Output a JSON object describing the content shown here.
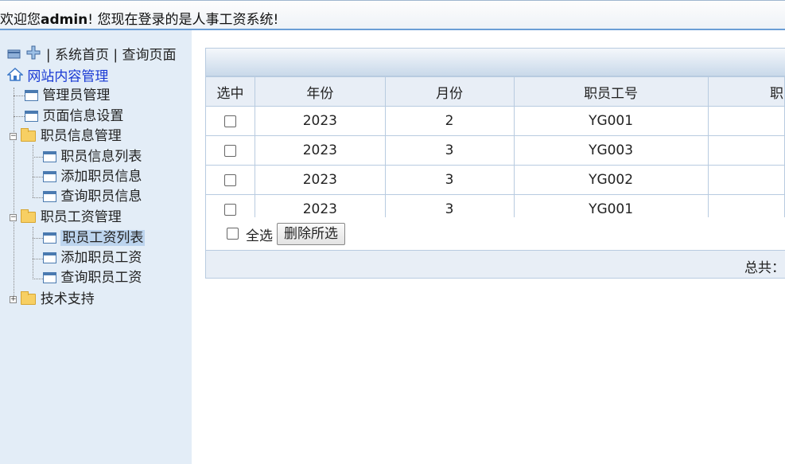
{
  "header": {
    "welcome_prefix": "欢迎您",
    "user": "admin",
    "welcome_suffix": "! 您现在登录的是人事工资系统!"
  },
  "sidebar": {
    "toolbar": {
      "home": "系统首页",
      "sep1": "|",
      "sep0": "|",
      "query": "查询页面"
    },
    "root": "网站内容管理",
    "items": [
      {
        "label": "管理员管理"
      },
      {
        "label": "页面信息设置"
      },
      {
        "label": "职员信息管理"
      },
      {
        "label": "职员信息列表"
      },
      {
        "label": "添加职员信息"
      },
      {
        "label": "查询职员信息"
      },
      {
        "label": "职员工资管理"
      },
      {
        "label": "职员工资列表"
      },
      {
        "label": "添加职员工资"
      },
      {
        "label": "查询职员工资"
      },
      {
        "label": "技术支持"
      }
    ]
  },
  "table": {
    "headers": [
      "选中",
      "年份",
      "月份",
      "职员工号",
      "职"
    ],
    "rows": [
      {
        "year": "2023",
        "month": "2",
        "emp": "YG001"
      },
      {
        "year": "2023",
        "month": "3",
        "emp": "YG003"
      },
      {
        "year": "2023",
        "month": "3",
        "emp": "YG002"
      },
      {
        "year": "2023",
        "month": "3",
        "emp": "YG001"
      }
    ]
  },
  "actions": {
    "select_all": "全选",
    "delete": "删除所选"
  },
  "footer": {
    "total": "总共："
  }
}
